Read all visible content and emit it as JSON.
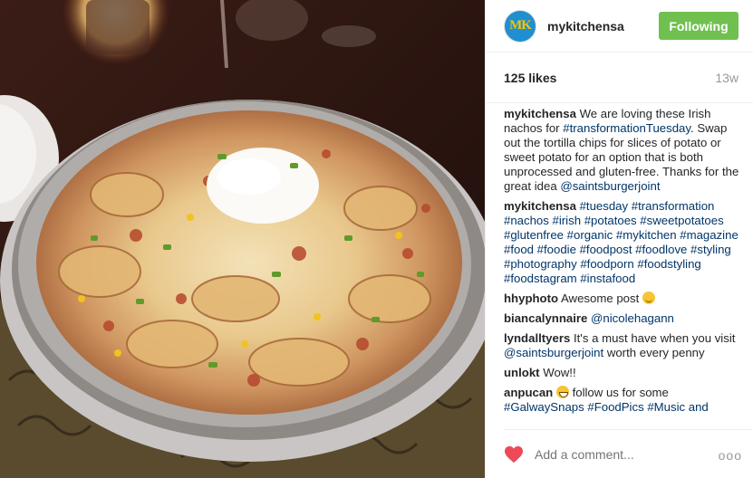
{
  "header": {
    "avatar_text": "MK",
    "username": "mykitchensa",
    "follow_label": "Following"
  },
  "stats": {
    "likes": "125 likes",
    "age": "13w"
  },
  "caption": {
    "user": "mykitchensa",
    "text_1": "We are loving these Irish nachos for",
    "tag_1": "#transformationTuesday",
    "text_2": ". Swap out the tortilla chips for slices of potato or sweet potato for an option that is both unprocessed and gluten-free. Thanks for the great idea",
    "mention": "@saintsburgerjoint"
  },
  "hashtag_comment": {
    "user": "mykitchensa",
    "tags": "#tuesday #transformation #nachos #irish #potatoes #sweetpotatoes #glutenfree #organic #mykitchen #magazine #food #foodie #foodpost #foodlove #styling #photography #foodporn #foodstyling #foodstagram #instafood"
  },
  "comments": [
    {
      "user": "hhyphoto",
      "text": "Awesome post"
    },
    {
      "user": "biancalynnaire",
      "mention": "@nicolehagann"
    },
    {
      "user": "lyndalltyers",
      "text": "It's a must have when you visit",
      "mention": "@saintsburgerjoint",
      "text_after": "worth every penny"
    },
    {
      "user": "unlokt",
      "text": "Wow!!"
    },
    {
      "user": "anpucan",
      "text": "follow us for some",
      "tags": "#GalwaySnaps #FoodPics #Music and"
    }
  ],
  "footer": {
    "placeholder": "Add a comment...",
    "more": "ooo"
  },
  "colors": {
    "follow_green": "#70c050",
    "link_blue": "#003569",
    "heart_red": "#ed4956"
  },
  "icons": [
    "heart-icon",
    "wink-emoji-icon",
    "grin-emoji-icon",
    "more-options-icon"
  ]
}
